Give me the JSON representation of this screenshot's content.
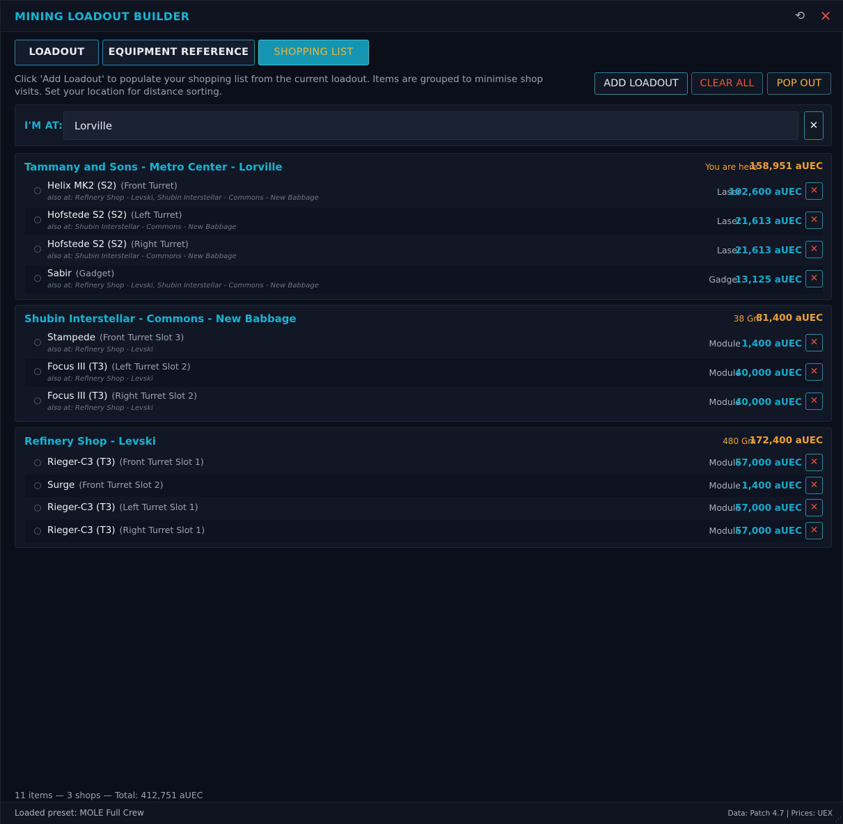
{
  "app": {
    "title": "MINING LOADOUT BUILDER"
  },
  "icons": {
    "reset": "refresh-icon",
    "close": "close-icon",
    "remove": "close-icon",
    "clear": "close-icon"
  },
  "colors": {
    "accent": "#17b3cf",
    "price": "#1aa8cc",
    "warning": "#f0a035",
    "danger": "#e05040",
    "background": "#0b0f1a"
  },
  "tabs": [
    {
      "label": "LOADOUT"
    },
    {
      "label": "EQUIPMENT REFERENCE"
    },
    {
      "label": "SHOPPING LIST",
      "active": true
    }
  ],
  "intro": "Click 'Add Loadout' to populate your shopping list from the current loadout. Items are grouped to minimise shop visits. Set your location for distance sorting.",
  "actions": {
    "add": "ADD LOADOUT",
    "clear": "CLEAR ALL",
    "pop": "POP OUT"
  },
  "location": {
    "label": "I'M AT:",
    "value": "Lorville"
  },
  "groups": [
    {
      "title": "Tammany and Sons - Metro Center - Lorville",
      "distance": "You are here",
      "total": "158,951 aUEC",
      "items": [
        {
          "name": "Helix MK2 (S2)",
          "slot": "(Front Turret)",
          "also": "also at: Refinery Shop - Levski, Shubin Interstellar - Commons - New Babbage",
          "type": "Laser",
          "price": "102,600 aUEC"
        },
        {
          "name": "Hofstede S2 (S2)",
          "slot": "(Left Turret)",
          "also": "also at: Shubin Interstellar - Commons - New Babbage",
          "type": "Laser",
          "price": "21,613 aUEC"
        },
        {
          "name": "Hofstede S2 (S2)",
          "slot": "(Right Turret)",
          "also": "also at: Shubin Interstellar - Commons - New Babbage",
          "type": "Laser",
          "price": "21,613 aUEC"
        },
        {
          "name": "Sabir",
          "slot": "(Gadget)",
          "also": "also at: Refinery Shop - Levski, Shubin Interstellar - Commons - New Babbage",
          "type": "Gadget",
          "price": "13,125 aUEC"
        }
      ]
    },
    {
      "title": "Shubin Interstellar - Commons - New Babbage",
      "distance": "38 Gm",
      "total": "81,400 aUEC",
      "items": [
        {
          "name": "Stampede",
          "slot": "(Front Turret Slot 3)",
          "also": "also at: Refinery Shop - Levski",
          "type": "Module",
          "price": "1,400 aUEC"
        },
        {
          "name": "Focus III (T3)",
          "slot": "(Left Turret Slot 2)",
          "also": "also at: Refinery Shop - Levski",
          "type": "Module",
          "price": "40,000 aUEC"
        },
        {
          "name": "Focus III (T3)",
          "slot": "(Right Turret Slot 2)",
          "also": "also at: Refinery Shop - Levski",
          "type": "Module",
          "price": "40,000 aUEC"
        }
      ]
    },
    {
      "title": "Refinery Shop - Levski",
      "distance": "480 Gm",
      "total": "172,400 aUEC",
      "items": [
        {
          "name": "Rieger-C3 (T3)",
          "slot": "(Front Turret Slot 1)",
          "type": "Module",
          "price": "57,000 aUEC"
        },
        {
          "name": "Surge",
          "slot": "(Front Turret Slot 2)",
          "type": "Module",
          "price": "1,400 aUEC"
        },
        {
          "name": "Rieger-C3 (T3)",
          "slot": "(Left Turret Slot 1)",
          "type": "Module",
          "price": "57,000 aUEC"
        },
        {
          "name": "Rieger-C3 (T3)",
          "slot": "(Right Turret Slot 1)",
          "type": "Module",
          "price": "57,000 aUEC"
        }
      ]
    }
  ],
  "summary": "11 items — 3 shops — Total: 412,751 aUEC",
  "footer": {
    "preset": "Loaded preset: MOLE Full Crew",
    "data_source": "Data: Patch 4.7 | Prices: UEX"
  }
}
